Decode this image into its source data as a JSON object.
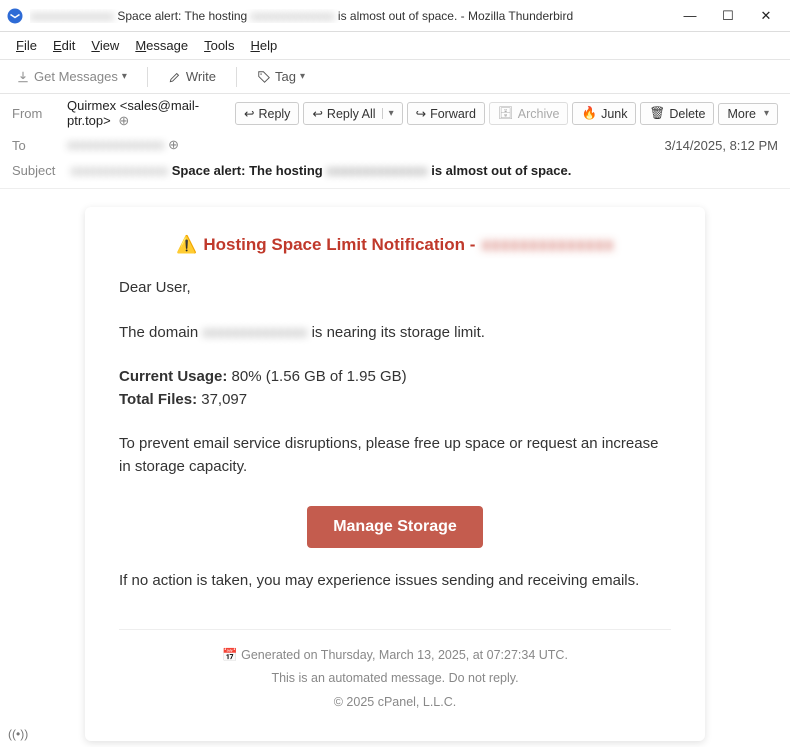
{
  "window": {
    "title_prefix": "Space alert: The hosting",
    "title_suffix": "is almost out of space. - Mozilla Thunderbird"
  },
  "menu": {
    "file": "File",
    "edit": "Edit",
    "view": "View",
    "message": "Message",
    "tools": "Tools",
    "help": "Help"
  },
  "toolbar": {
    "get": "Get Messages",
    "write": "Write",
    "tag": "Tag"
  },
  "actions": {
    "reply": "Reply",
    "reply_all": "Reply All",
    "forward": "Forward",
    "archive": "Archive",
    "junk": "Junk",
    "delete": "Delete",
    "more": "More"
  },
  "headers": {
    "from_label": "From",
    "from_value": "Quirmex <sales@mail-ptr.top>",
    "to_label": "To",
    "subject_label": "Subject",
    "subject_prefix": "Space alert: The hosting",
    "subject_suffix": "is almost out of space.",
    "date": "3/14/2025, 8:12 PM"
  },
  "body": {
    "title": "Hosting Space Limit Notification -",
    "greeting": "Dear User,",
    "line1_a": "The domain",
    "line1_b": "is nearing its storage limit.",
    "usage_label": "Current Usage:",
    "usage_value": "80% (1.56 GB of 1.95 GB)",
    "files_label": "Total Files:",
    "files_value": "37,097",
    "para2": "To prevent email service disruptions, please free up space or request an increase in storage capacity.",
    "button": "Manage Storage",
    "para3": "If no action is taken, you may experience issues sending and receiving emails.",
    "gen": "Generated on Thursday, March 13, 2025, at 07:27:34 UTC.",
    "auto": "This is an automated message. Do not reply.",
    "copy": "© 2025 cPanel, L.L.C."
  },
  "status": "((•))"
}
